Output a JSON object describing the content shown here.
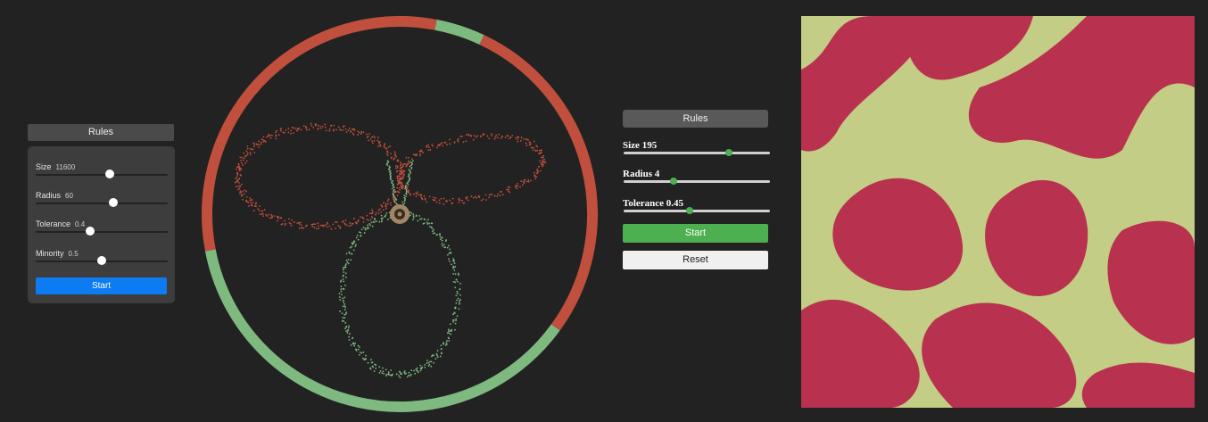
{
  "left_panel": {
    "header": "Rules",
    "sliders": [
      {
        "label": "Size",
        "value": "11600",
        "level": 0.56
      },
      {
        "label": "Radius",
        "value": "60",
        "level": 0.59
      },
      {
        "label": "Tolerance",
        "value": "0.4",
        "level": 0.41
      },
      {
        "label": "Minority",
        "value": "0.5",
        "level": 0.5
      }
    ],
    "start_label": "Start"
  },
  "ring_chart": {
    "colors": {
      "red": "#c0503d",
      "green": "#7eb980",
      "bg": "#232323",
      "center": "#a08768"
    },
    "ring_segments": [
      {
        "color": "red",
        "fraction": 0.14
      },
      {
        "color": "green",
        "fraction": 0.04
      },
      {
        "color": "red",
        "fraction": 0.28
      },
      {
        "color": "green",
        "fraction": 0.37
      },
      {
        "color": "red",
        "fraction": 0.17
      }
    ]
  },
  "middle_panel": {
    "header": "Rules",
    "sliders": [
      {
        "label": "Size 195",
        "level": 0.72
      },
      {
        "label": "Radius 4",
        "level": 0.34
      },
      {
        "label": "Tolerance 0.45",
        "level": 0.45
      }
    ],
    "start_label": "Start",
    "reset_label": "Reset"
  },
  "grid": {
    "colors": {
      "a": "#c4cd85",
      "b": "#b8324f"
    }
  }
}
